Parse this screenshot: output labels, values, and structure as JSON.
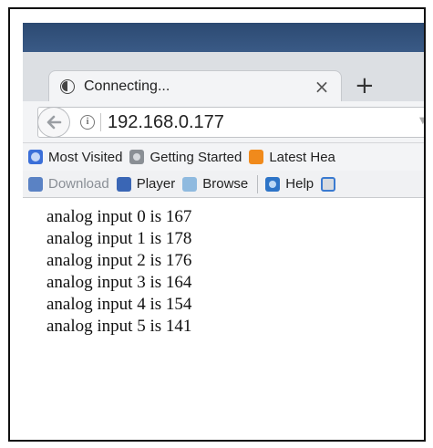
{
  "tab": {
    "title": "Connecting...",
    "close": "×",
    "new_tab": "+"
  },
  "address_bar": {
    "back": "←",
    "info": "i",
    "url": "192.168.0.177",
    "dropdown": "▼"
  },
  "bookmarks": [
    {
      "label": "Most Visited",
      "icon": "globe-icon"
    },
    {
      "label": "Getting Started",
      "icon": "firefox-icon"
    },
    {
      "label": "Latest Hea",
      "icon": "rss-icon"
    }
  ],
  "toolbar2": [
    {
      "label": "Download",
      "icon": "download-icon"
    },
    {
      "label": "Player",
      "icon": "monitor-icon"
    },
    {
      "label": "Browse",
      "icon": "folder-icon"
    },
    {
      "label": "Help",
      "icon": "help-icon"
    }
  ],
  "page": {
    "lines": [
      "analog input 0 is 167",
      "analog input 1 is 178",
      "analog input 2 is 176",
      "analog input 3 is 164",
      "analog input 4 is 154",
      "analog input 5 is 141"
    ]
  }
}
